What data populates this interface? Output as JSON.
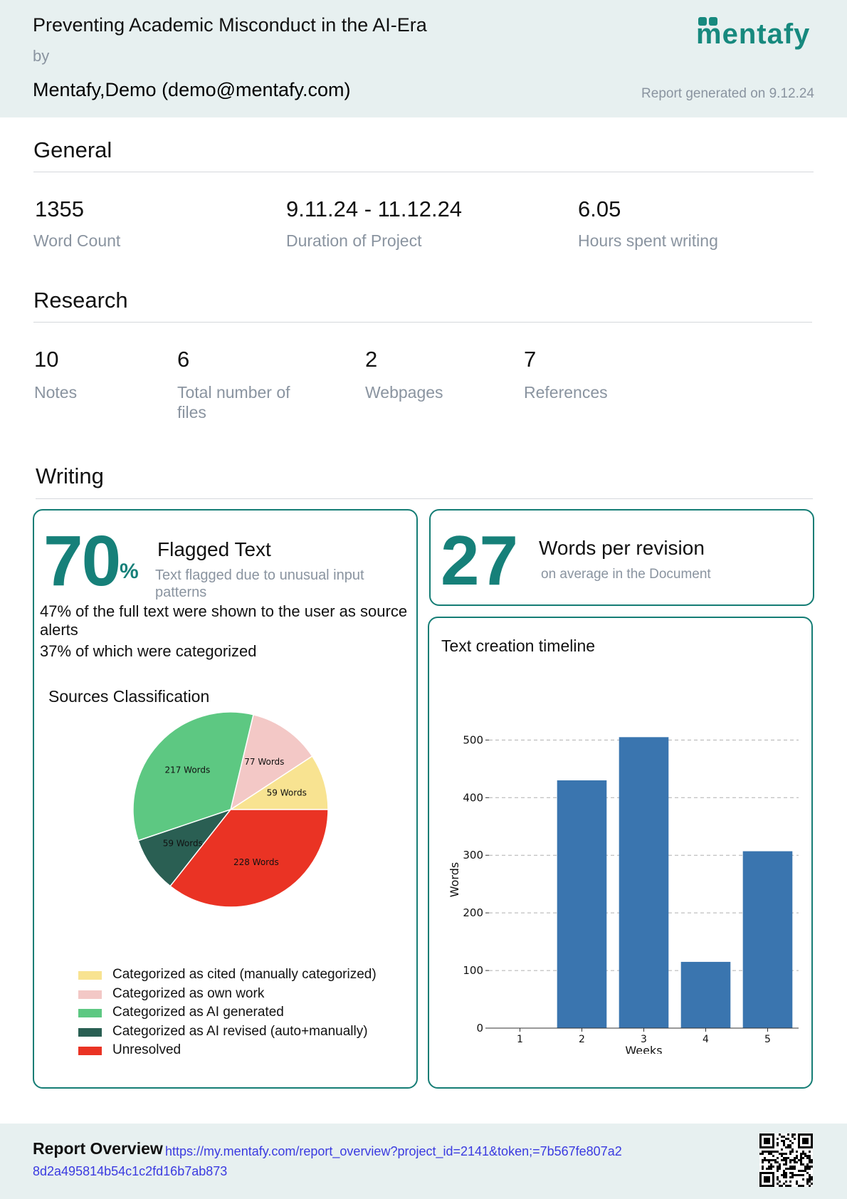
{
  "header": {
    "title": "Preventing Academic Misconduct in the AI-Era",
    "by": "by",
    "author": "Mentafy,Demo (demo@mentafy.com)",
    "generated": "Report generated on 9.12.24",
    "logo_text": "mentafy"
  },
  "general": {
    "title": "General",
    "stats": [
      {
        "value": "1355",
        "label": "Word Count"
      },
      {
        "value": "9.11.24 - 11.12.24",
        "label": "Duration of Project"
      },
      {
        "value": "6.05",
        "label": "Hours spent writing"
      }
    ]
  },
  "research": {
    "title": "Research",
    "stats": [
      {
        "value": "10",
        "label": "Notes"
      },
      {
        "value": "6",
        "label": "Total number of files"
      },
      {
        "value": "2",
        "label": "Webpages"
      },
      {
        "value": "7",
        "label": "References"
      }
    ]
  },
  "writing": {
    "title": "Writing",
    "flagged": {
      "value": "70",
      "unit": "%",
      "title": "Flagged Text",
      "subtitle": "Text flagged due to unusual input patterns",
      "line1": "47% of the full text were shown to the user as source alerts",
      "line2": "37% of which were categorized"
    },
    "revision": {
      "value": "27",
      "title": "Words per revision",
      "subtitle": "on average in the Document"
    }
  },
  "colors": {
    "accent": "#168079",
    "cited": "#f8e391",
    "own_work": "#f3c8c6",
    "ai_generated": "#5dc882",
    "ai_revised": "#2a5f53",
    "unresolved": "#ea3324",
    "bar": "#3a75af"
  },
  "chart_data": [
    {
      "type": "pie",
      "title": "Sources Classification",
      "slices": [
        {
          "label": "59 Words",
          "value": 59,
          "legend": "Categorized as cited (manually categorized)",
          "color": "#f8e391"
        },
        {
          "label": "77 Words",
          "value": 77,
          "legend": "Categorized as own work",
          "color": "#f3c8c6"
        },
        {
          "label": "217 Words",
          "value": 217,
          "legend": "Categorized as AI generated",
          "color": "#5dc882"
        },
        {
          "label": "59 Words",
          "value": 59,
          "legend": "Categorized as AI revised (auto+manually)",
          "color": "#2a5f53"
        },
        {
          "label": "228 Words",
          "value": 228,
          "legend": "Unresolved",
          "color": "#ea3324"
        }
      ],
      "legend_placement": "bottom"
    },
    {
      "type": "bar",
      "title": "Text creation timeline",
      "categories": [
        "1",
        "2",
        "3",
        "4",
        "5"
      ],
      "values": [
        0,
        430,
        505,
        115,
        307
      ],
      "xlabel": "Weeks",
      "ylabel": "Words",
      "ylim": [
        0,
        500
      ],
      "yticks": [
        0,
        100,
        200,
        300,
        400,
        500
      ],
      "grid": "horizontal dashed"
    }
  ],
  "footer": {
    "title": "Report Overview",
    "link": "https://my.mentafy.com/report_overview?project_id=2141&token;=7b567fe807a28d2a495814b54c1c2fd16b7ab873"
  }
}
